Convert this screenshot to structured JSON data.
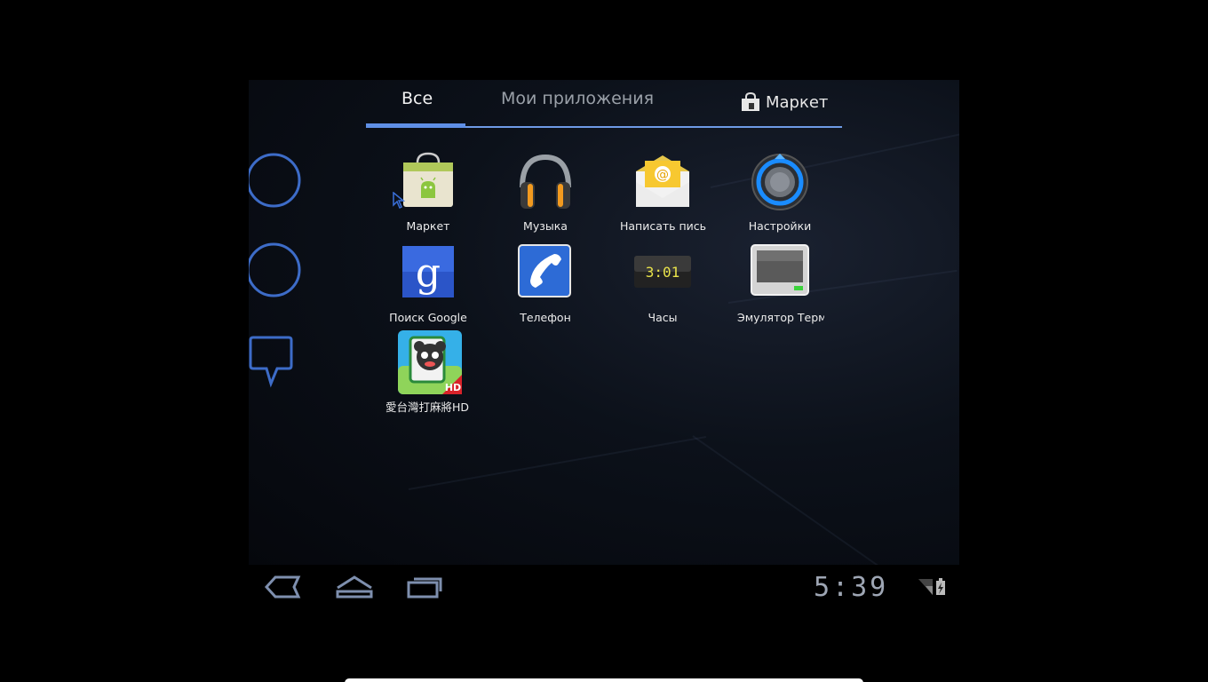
{
  "tabs": {
    "all": "Все",
    "my_apps": "Мои приложения",
    "market": "Маркет"
  },
  "apps": [
    {
      "label": "Маркет",
      "icon": "market-bag-icon"
    },
    {
      "label": "Музыка",
      "icon": "headphones-icon"
    },
    {
      "label": "Написать письмо",
      "icon": "email-envelope-icon"
    },
    {
      "label": "Настройки",
      "icon": "settings-knob-icon"
    },
    {
      "label": "Поиск Google",
      "icon": "google-search-icon"
    },
    {
      "label": "Телефон",
      "icon": "phone-handset-icon"
    },
    {
      "label": "Часы",
      "icon": "digital-clock-icon"
    },
    {
      "label": "Эмулятор Терминала",
      "icon": "terminal-emulator-icon"
    },
    {
      "label": "愛台灣打麻將HD",
      "icon": "mahjong-panda-icon"
    }
  ],
  "clock_icon_text": "3:01",
  "mahjong_badge": "HD",
  "status_bar": {
    "time": "5:39"
  },
  "colors": {
    "accent": "#5f8fe6",
    "background": "#000000"
  }
}
